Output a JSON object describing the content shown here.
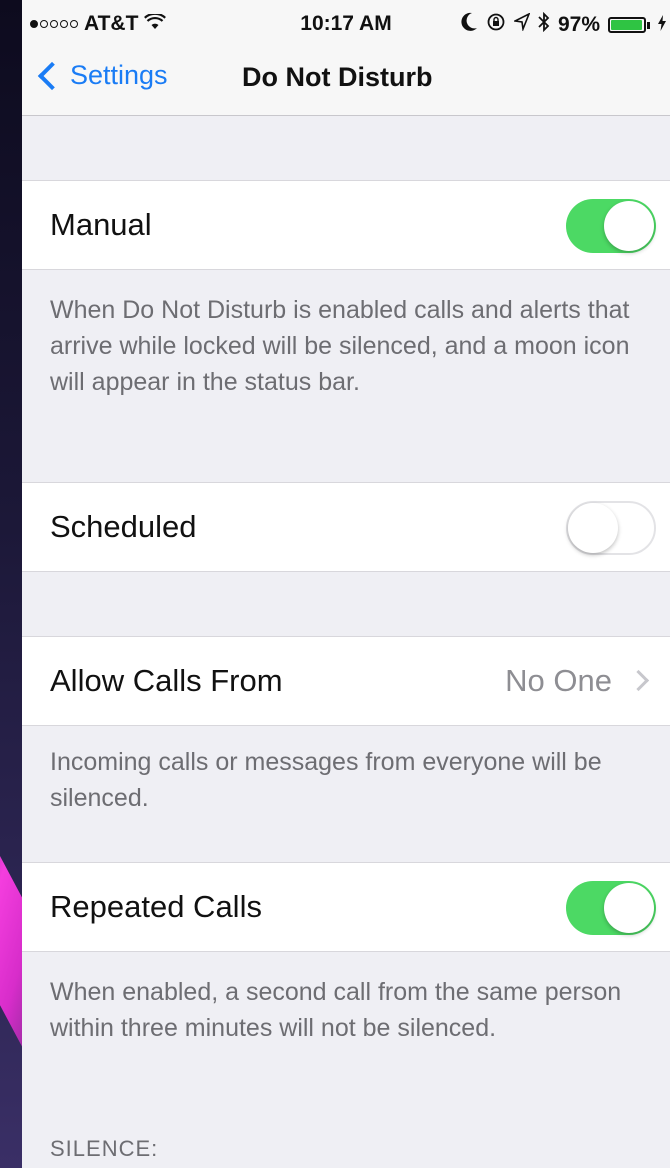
{
  "status_bar": {
    "carrier": "AT&T",
    "time": "10:17 AM",
    "battery": "97%",
    "battery_level": 0.97,
    "icons": [
      "signal-dots-icon",
      "wifi-icon",
      "moon-icon",
      "lock-rotation-icon",
      "location-icon",
      "bluetooth-icon",
      "battery-icon",
      "charging-icon"
    ]
  },
  "nav": {
    "back_label": "Settings",
    "title": "Do Not Disturb"
  },
  "manual": {
    "label": "Manual",
    "enabled": true,
    "footer": "When Do Not Disturb is enabled calls and alerts that arrive while locked will be silenced, and a moon icon will appear in the status bar."
  },
  "scheduled": {
    "label": "Scheduled",
    "enabled": false
  },
  "allow_calls": {
    "label": "Allow Calls From",
    "value": "No One",
    "footer": "Incoming calls or messages from everyone will be silenced."
  },
  "repeated_calls": {
    "label": "Repeated Calls",
    "enabled": true,
    "footer": "When enabled, a second call from the same person within three minutes will not be silenced."
  },
  "silence_section": {
    "header": "SILENCE:"
  },
  "colors": {
    "accent": "#1a7cf5",
    "toggle_on": "#4cd964",
    "background": "#efeff4",
    "secondary_text": "#6d6d72"
  }
}
